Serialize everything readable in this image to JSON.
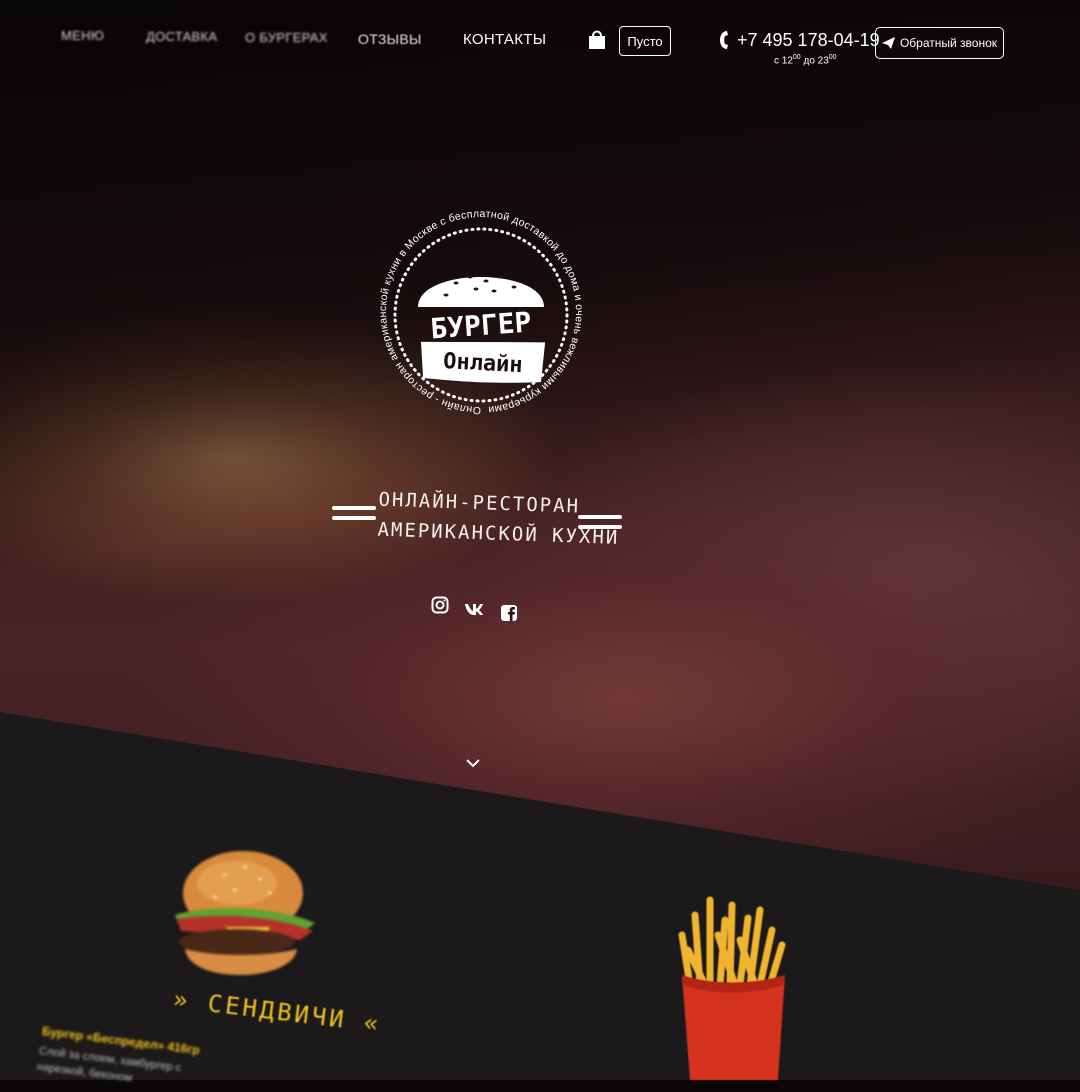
{
  "nav": {
    "items": [
      {
        "label": "МЕНЮ"
      },
      {
        "label": "ДОСТАВКА"
      },
      {
        "label": "О БУРГЕРАХ"
      },
      {
        "label": "ОТЗЫВЫ"
      },
      {
        "label": "КОНТАКТЫ"
      }
    ]
  },
  "cart": {
    "label": "Пусто",
    "icon": "shopping-bag-icon"
  },
  "contact": {
    "phone": "+7 495 178-04-19",
    "hours_prefix": "с 12",
    "hours_from_sup": "00",
    "hours_mid": " до 23",
    "hours_to_sup": "00",
    "callback_label": "Обратный звонок"
  },
  "logo": {
    "line1": "БУРГЕР",
    "line2": "Онлайн",
    "ring_text": "Онлайн - ресторан американской кухни в Москве с бесплатной доставкой до дома и очень вежливыми курьерами"
  },
  "hero": {
    "tagline_line1": "Онлайн-ресторан",
    "tagline_line2": "американской кухни"
  },
  "socials": [
    {
      "name": "instagram-icon"
    },
    {
      "name": "vk-icon"
    },
    {
      "name": "facebook-icon"
    }
  ],
  "menu": {
    "category_title": "» СЕНДВИЧИ «",
    "product_name": "Бургер «Беспредел» 416гр",
    "product_desc_line1": "Слой за слоем, хамбургер с",
    "product_desc_line2": "нарезкой, беконом"
  },
  "colors": {
    "accent_yellow": "#f2c21c",
    "hero_dark": "#2a1416",
    "menu_bg": "#1b1919"
  }
}
